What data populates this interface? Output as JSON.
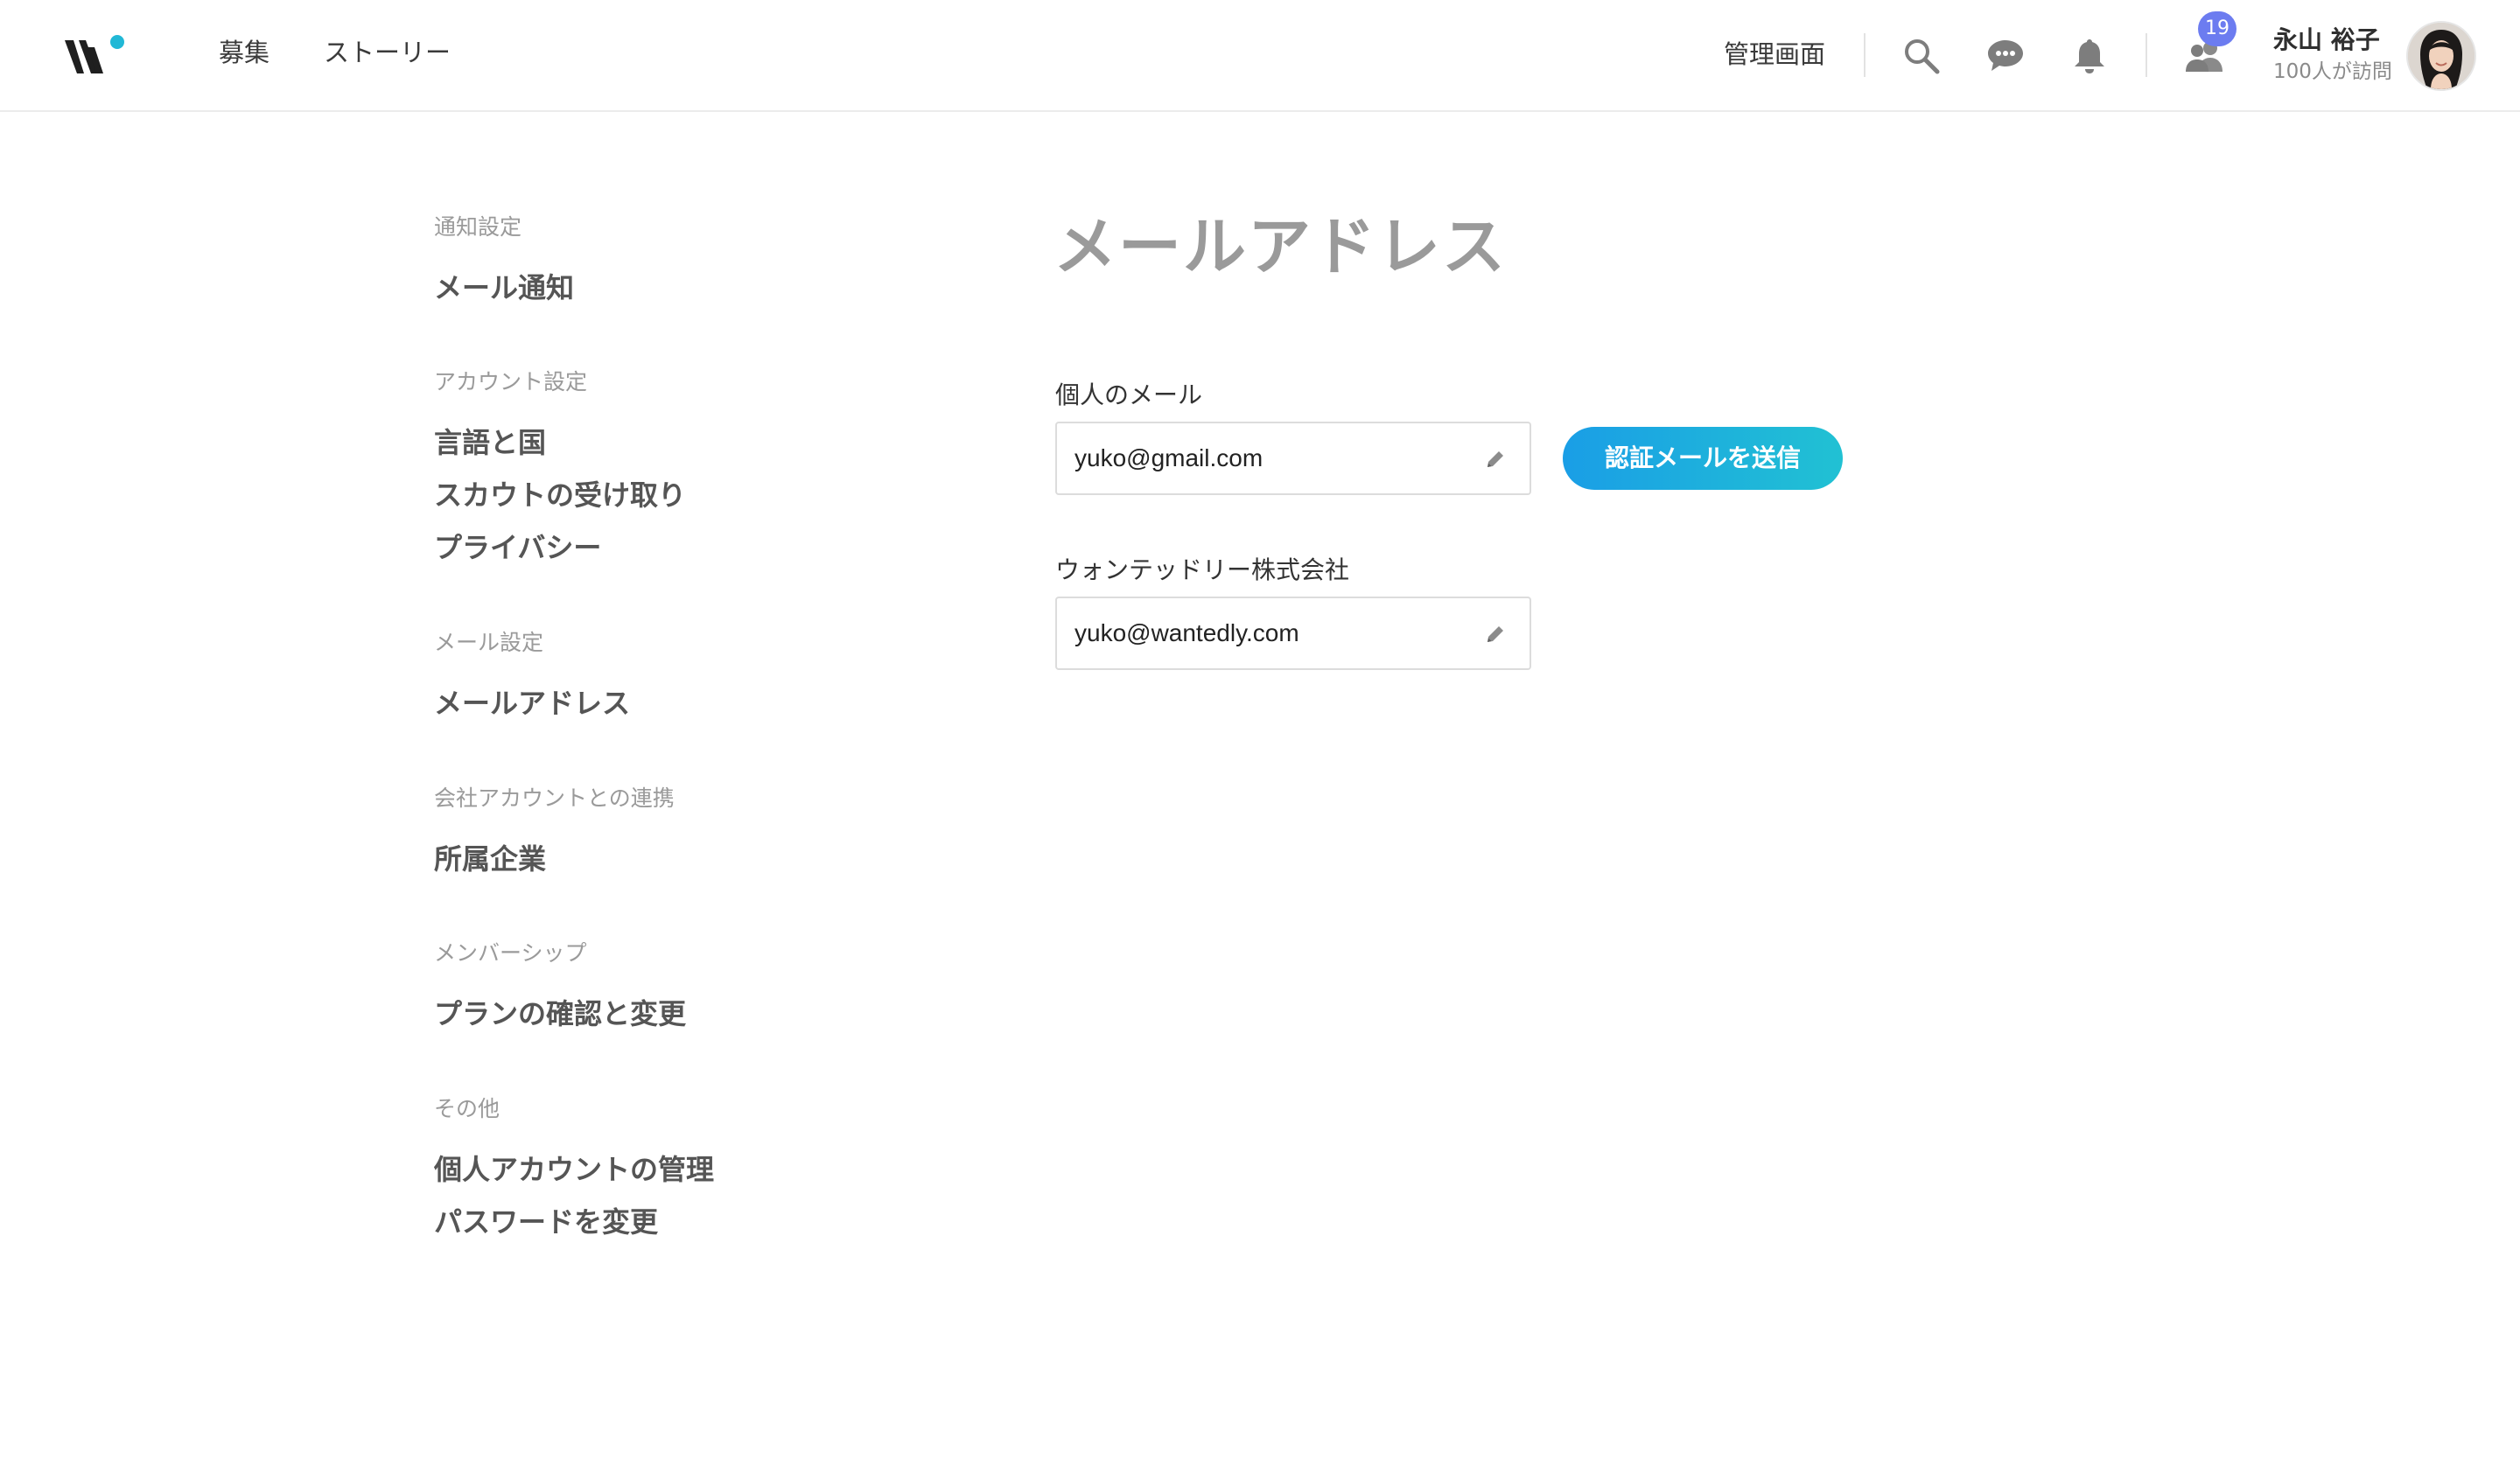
{
  "header": {
    "nav": [
      "募集",
      "ストーリー"
    ],
    "admin_label": "管理画面",
    "badge_count": "19",
    "user_name": "永山 裕子",
    "user_sub": "100人が訪問",
    "logo_dot_color": "#21b8d6"
  },
  "sidebar": {
    "sections": [
      {
        "label": "通知設定",
        "items": [
          "メール通知"
        ]
      },
      {
        "label": "アカウント設定",
        "items": [
          "言語と国",
          "スカウトの受け取り",
          "プライバシー"
        ]
      },
      {
        "label": "メール設定",
        "items": [
          "メールアドレス"
        ]
      },
      {
        "label": "会社アカウントとの連携",
        "items": [
          "所属企業"
        ]
      },
      {
        "label": "メンバーシップ",
        "items": [
          "プランの確認と変更"
        ]
      },
      {
        "label": "その他",
        "items": [
          "個人アカウントの管理",
          "パスワードを変更"
        ]
      }
    ]
  },
  "main": {
    "title": "メールアドレス",
    "personal_label": "個人のメール",
    "personal_email": "yuko@gmail.com",
    "send_button": "認証メールを送信",
    "company_label": "ウォンテッドリー株式会社",
    "company_email": "yuko@wantedly.com"
  },
  "colors": {
    "accent_gradient_start": "#1a9ee6",
    "accent_gradient_end": "#21c1d3",
    "badge": "#6c7cf0"
  },
  "icons": [
    "wantedly-logo",
    "search-icon",
    "chat-icon",
    "bell-icon",
    "people-icon",
    "pencil-icon"
  ]
}
